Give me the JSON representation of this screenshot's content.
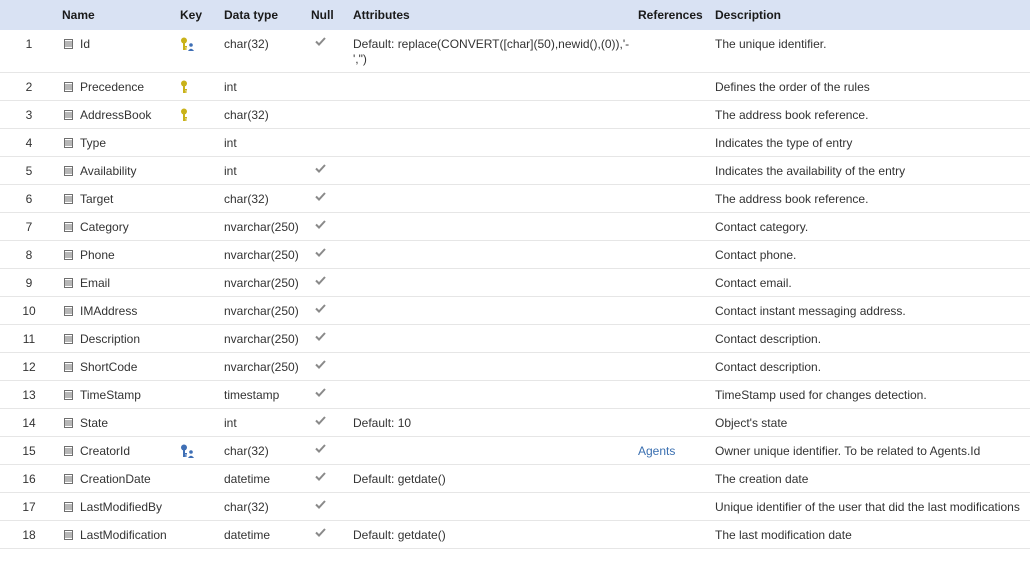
{
  "headers": {
    "number": "",
    "name": "Name",
    "key": "Key",
    "data_type": "Data type",
    "null": "Null",
    "attributes": "Attributes",
    "references": "References",
    "description": "Description"
  },
  "colors": {
    "header_bg": "#d9e2f3",
    "key_gold": "#c9b21a",
    "key_blue": "#3f6fb5",
    "check": "#8a8a8a",
    "link": "#3a6fb0"
  },
  "rows": [
    {
      "num": "1",
      "name": "Id",
      "key": "primary-foreign-key-icon",
      "type": "char(32)",
      "null": true,
      "attributes": "Default: replace(CONVERT([char](50),newid(),(0)),'-',\")",
      "references": "",
      "description": "The unique identifier."
    },
    {
      "num": "2",
      "name": "Precedence",
      "key": "primary-key-icon",
      "type": "int",
      "null": false,
      "attributes": "",
      "references": "",
      "description": "Defines the order of the rules"
    },
    {
      "num": "3",
      "name": "AddressBook",
      "key": "primary-key-icon",
      "type": "char(32)",
      "null": false,
      "attributes": "",
      "references": "",
      "description": "The address book reference."
    },
    {
      "num": "4",
      "name": "Type",
      "key": "",
      "type": "int",
      "null": false,
      "attributes": "",
      "references": "",
      "description": "Indicates the type of entry"
    },
    {
      "num": "5",
      "name": "Availability",
      "key": "",
      "type": "int",
      "null": true,
      "attributes": "",
      "references": "",
      "description": "Indicates the availability of the entry"
    },
    {
      "num": "6",
      "name": "Target",
      "key": "",
      "type": "char(32)",
      "null": true,
      "attributes": "",
      "references": "",
      "description": "The address book reference."
    },
    {
      "num": "7",
      "name": "Category",
      "key": "",
      "type": "nvarchar(250)",
      "null": true,
      "attributes": "",
      "references": "",
      "description": "Contact category."
    },
    {
      "num": "8",
      "name": "Phone",
      "key": "",
      "type": "nvarchar(250)",
      "null": true,
      "attributes": "",
      "references": "",
      "description": "Contact phone."
    },
    {
      "num": "9",
      "name": "Email",
      "key": "",
      "type": "nvarchar(250)",
      "null": true,
      "attributes": "",
      "references": "",
      "description": "Contact email."
    },
    {
      "num": "10",
      "name": "IMAddress",
      "key": "",
      "type": "nvarchar(250)",
      "null": true,
      "attributes": "",
      "references": "",
      "description": "Contact instant messaging address."
    },
    {
      "num": "11",
      "name": "Description",
      "key": "",
      "type": "nvarchar(250)",
      "null": true,
      "attributes": "",
      "references": "",
      "description": "Contact description."
    },
    {
      "num": "12",
      "name": "ShortCode",
      "key": "",
      "type": "nvarchar(250)",
      "null": true,
      "attributes": "",
      "references": "",
      "description": "Contact description."
    },
    {
      "num": "13",
      "name": "TimeStamp",
      "key": "",
      "type": "timestamp",
      "null": true,
      "attributes": "",
      "references": "",
      "description": "TimeStamp used for changes detection."
    },
    {
      "num": "14",
      "name": "State",
      "key": "",
      "type": "int",
      "null": true,
      "attributes": "Default: 10",
      "references": "",
      "description": "Object's state"
    },
    {
      "num": "15",
      "name": "CreatorId",
      "key": "foreign-key-icon",
      "type": "char(32)",
      "null": true,
      "attributes": "",
      "references": "Agents",
      "description": "Owner unique identifier. To be related to Agents.Id"
    },
    {
      "num": "16",
      "name": "CreationDate",
      "key": "",
      "type": "datetime",
      "null": true,
      "attributes": "Default: getdate()",
      "references": "",
      "description": "The creation date"
    },
    {
      "num": "17",
      "name": "LastModifiedBy",
      "key": "",
      "type": "char(32)",
      "null": true,
      "attributes": "",
      "references": "",
      "description": "Unique identifier of the user that did the last modifications"
    },
    {
      "num": "18",
      "name": "LastModification",
      "key": "",
      "type": "datetime",
      "null": true,
      "attributes": "Default: getdate()",
      "references": "",
      "description": "The last modification date"
    }
  ]
}
